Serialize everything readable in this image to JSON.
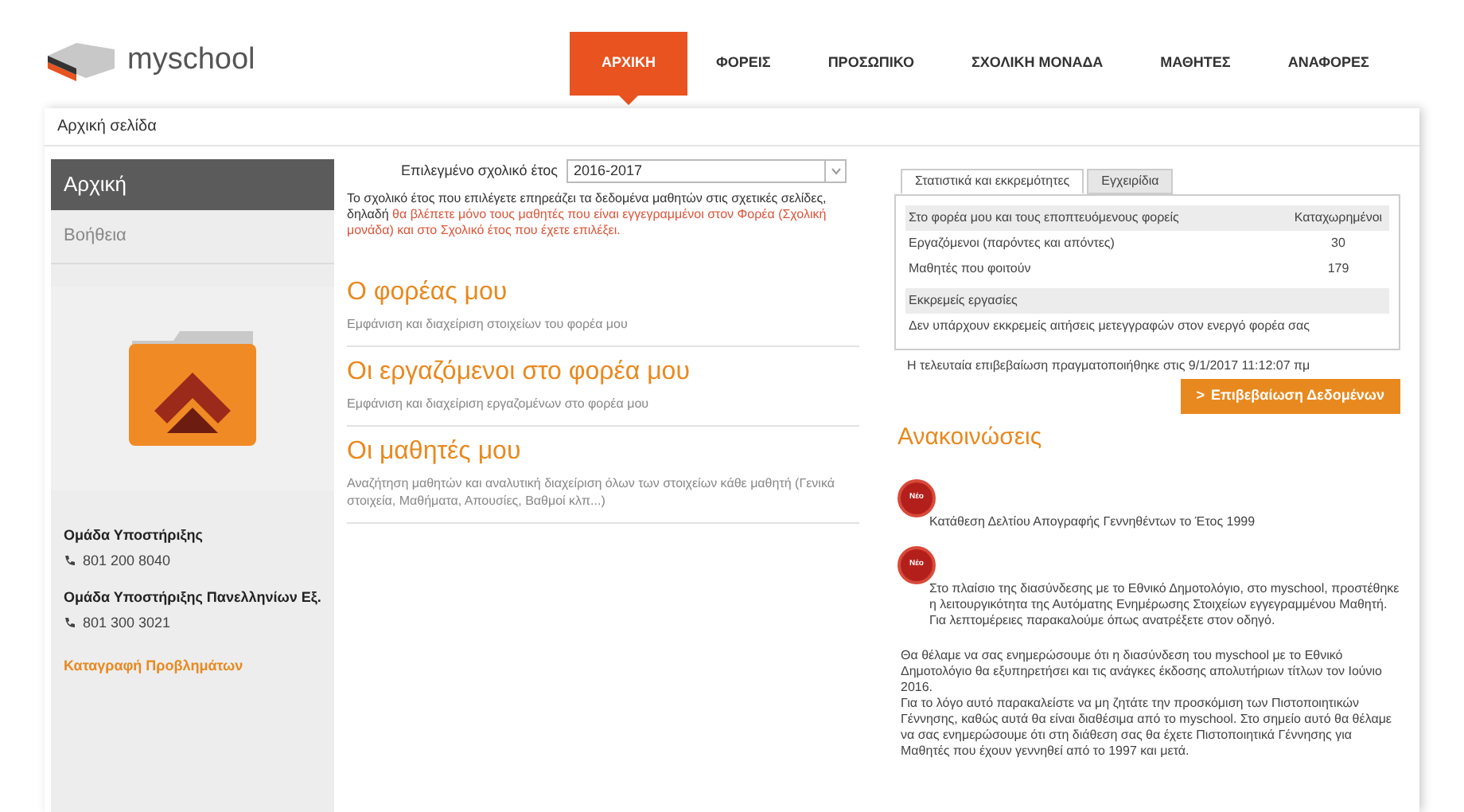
{
  "logo": {
    "text": "myschool"
  },
  "nav": [
    {
      "label": "ΑΡΧΙΚΗ",
      "selected": true
    },
    {
      "label": "ΦΟΡΕΙΣ",
      "selected": false
    },
    {
      "label": "ΠΡΟΣΩΠΙΚΟ",
      "selected": false
    },
    {
      "label": "ΣΧΟΛΙΚΗ ΜΟΝΑΔΑ",
      "selected": false
    },
    {
      "label": "ΜΑΘΗΤΕΣ",
      "selected": false
    },
    {
      "label": "ΑΝΑΦΟΡΕΣ",
      "selected": false
    }
  ],
  "breadcrumb": "Αρχική σελίδα",
  "sidebar": {
    "items": [
      {
        "label": "Αρχική",
        "selected": true
      },
      {
        "label": "Βοήθεια",
        "selected": false
      }
    ],
    "support": [
      {
        "title": "Ομάδα Υποστήριξης",
        "phone": "801 200 8040"
      },
      {
        "title": "Ομάδα Υποστήριξης Πανελληνίων Εξ.",
        "phone": "801 300 3021"
      }
    ],
    "link": "Καταγραφή Προβλημάτων"
  },
  "year_select": {
    "label": "Επιλεγμένο σχολικό έτος",
    "value": "2016-2017"
  },
  "intro": [
    {
      "text": "Το σχολικό έτος που επιλέγετε επηρεάζει τα δεδομένα μαθητών στις σχετικές σελίδες, δηλαδή ",
      "highlight": false
    },
    {
      "text": "θα βλέπετε μόνο τους μαθητές που είναι εγγεγραμμένοι στον Φορέα (Σχολική μονάδα) και στο Σχολικό έτος που έχετε επιλέξει.",
      "highlight": true
    }
  ],
  "sections": [
    {
      "title": "Ο φορέας μου",
      "description": "Εμφάνιση και διαχείριση στοιχείων του φορέα μου"
    },
    {
      "title": "Οι εργαζόμενοι στο φορέα μου",
      "description": "Εμφάνιση και διαχείριση εργαζομένων στο φορέα μου"
    },
    {
      "title": "Οι μαθητές μου",
      "description": "Αναζήτηση μαθητών και αναλυτική διαχείριση όλων των στοιχείων κάθε μαθητή (Γενικά στοιχεία, Μαθήματα, Απουσίες, Βαθμοί κλπ...)"
    }
  ],
  "stats_tabs": [
    {
      "label": "Στατιστικά και εκκρεμότητες",
      "selected": true
    },
    {
      "label": "Εγχειρίδια",
      "selected": false
    }
  ],
  "stats_table": {
    "columns": [
      "Στο φορέα μου και τους εποπτευόμενους φορείς",
      "Καταχωρημένοι"
    ],
    "rows": [
      [
        "Εργαζόμενοι (παρόντες και απόντες)",
        "30"
      ],
      [
        "Μαθητές που φοιτούν",
        "179"
      ]
    ]
  },
  "pending": {
    "title": "Εκκρεμείς εργασίες",
    "message": "Δεν υπάρχουν εκκρεμείς αιτήσεις μετεγγραφών στον ενεργό φορέα σας"
  },
  "last_confirmation": "Η τελευταία επιβεβαίωση πραγματοποιήθηκε στις 9/1/2017 11:12:07 πμ",
  "confirm_button": {
    "icon": ">",
    "label": "Επιβεβαίωση Δεδομένων"
  },
  "announcements_title": "Ανακοινώσεις",
  "announcements": [
    {
      "badge": "Νέο",
      "paragraphs": [
        "Κατάθεση Δελτίου Απογραφής Γεννηθέντων το Έτος 1999"
      ]
    },
    {
      "badge": "Νέο",
      "paragraphs": [
        "Στο πλαίσιο της διασύνδεσης με το Εθνικό Δημοτολόγιο, στο myschool, προστέθηκε η λειτουργικότητα της Αυτόματης Ενημέρωσης Στοιχείων εγγεγραμμένου Μαθητή. Για λεπτομέρειες παρακαλούμε όπως ανατρέξετε στον οδηγό."
      ]
    },
    {
      "paragraphs": [
        "Θα θέλαμε να σας ενημερώσουμε ότι η διασύνδεση του myschool με το Εθνικό Δημοτολόγιο θα εξυπηρετήσει και τις ανάγκες έκδοσης απολυτήριων τίτλων τον Ιούνιο 2016.",
        "Για το λόγο αυτό παρακαλείστε να μη ζητάτε την προσκόμιση των Πιστοποιητικών Γέννησης, καθώς αυτά θα είναι διαθέσιμα από το myschool. Στο σημείο αυτό θα θέλαμε να σας ενημερώσουμε ότι στη διάθεση σας θα έχετε Πιστοποιητικά Γέννησης για Μαθητές που έχουν γεννηθεί από το 1997 και μετά."
      ]
    }
  ]
}
